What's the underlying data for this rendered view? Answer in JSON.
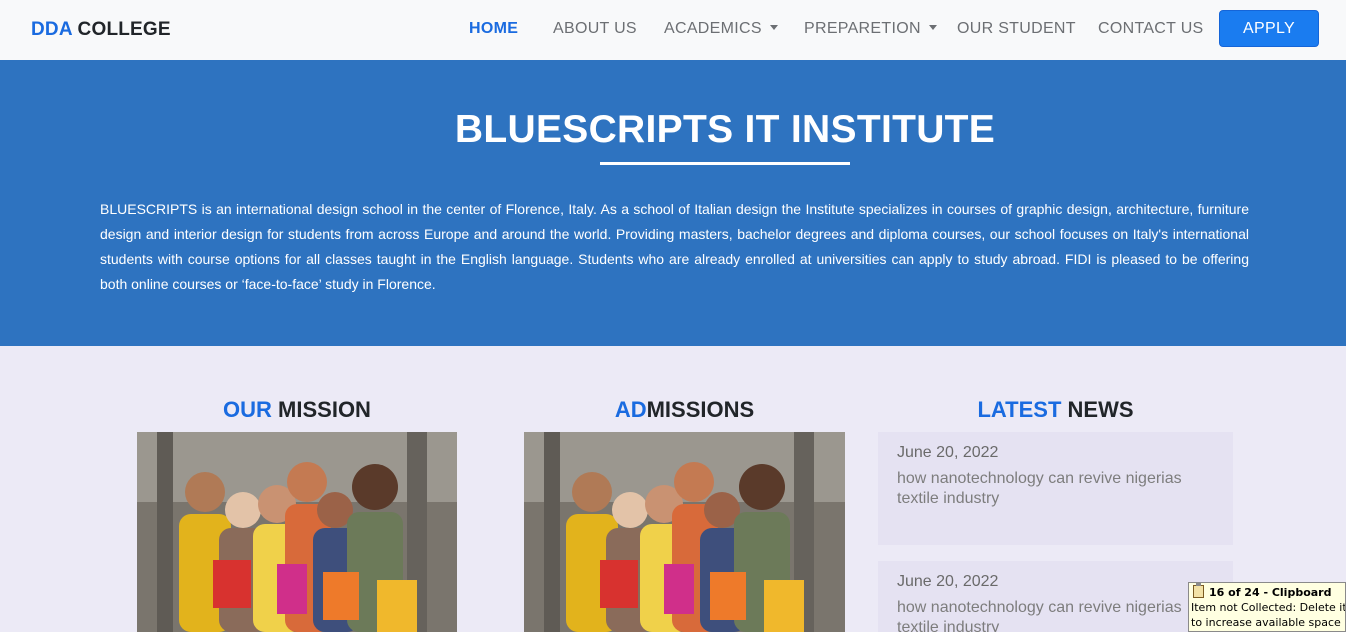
{
  "navbar": {
    "brand_accent": "DDA",
    "brand_rest": " COLLEGE",
    "items": [
      {
        "label": "HOME"
      },
      {
        "label": "ABOUT US"
      },
      {
        "label": "ACADEMICS"
      },
      {
        "label": "PREPARETION"
      },
      {
        "label": "OUR STUDENT"
      },
      {
        "label": "CONTACT US"
      }
    ],
    "apply_label": "APPLY"
  },
  "hero": {
    "title": "BLUESCRIPTS IT INSTITUTE",
    "text": "BLUESCRIPTS is an international design school in the center of Florence, Italy. As a school of Italian design the Institute specializes in courses of graphic design, architecture, furniture design and interior design for students from across Europe and around the world. Providing masters, bachelor degrees and diploma courses, our school focuses on Italy's international students with course options for all classes taught in the English language. Students who are already enrolled at universities can apply to study abroad. FIDI is pleased to be offering both online courses or ‘face-to-face’ study in Florence."
  },
  "sections": {
    "mission": {
      "accent": "OUR",
      "rest": " MISSION"
    },
    "admissions": {
      "accent": "AD",
      "rest": "MISSIONS"
    },
    "news": {
      "accent": "LATEST",
      "rest": " NEWS"
    }
  },
  "news": [
    {
      "date": "June 20, 2022",
      "title": "how nanotechnology can revive nigerias textile industry"
    },
    {
      "date": "June 20, 2022",
      "title": "how nanotechnology can revive nigerias textile industry"
    }
  ],
  "clipboard_tooltip": {
    "header": "16 of 24 - Clipboard",
    "line1": "Item not Collected: Delete items",
    "line2": "to increase available space"
  },
  "colors": {
    "accent": "#1a6be0",
    "hero_bg": "#2e73c0",
    "page_bg": "#eceaf6",
    "button": "#1a7cf0"
  }
}
